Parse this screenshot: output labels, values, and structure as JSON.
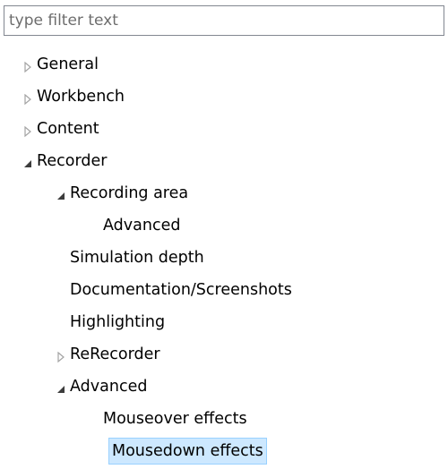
{
  "filter": {
    "placeholder": "type filter text",
    "value": ""
  },
  "colors": {
    "selection_bg": "#cde8ff",
    "selection_border": "#99d1ff",
    "twisty_collapsed": "#a3a3a3",
    "twisty_expanded": "#3c3c3c"
  },
  "tree": {
    "general": "General",
    "workbench": "Workbench",
    "content": "Content",
    "recorder": "Recorder",
    "recording_area": "Recording area",
    "recording_area_advanced": "Advanced",
    "simulation_depth": "Simulation depth",
    "documentation_screenshots": "Documentation/Screenshots",
    "highlighting": "Highlighting",
    "rerecorder": "ReRecorder",
    "advanced": "Advanced",
    "mouseover_effects": "Mouseover effects",
    "mousedown_effects": "Mousedown effects"
  },
  "selected_item": "Mousedown effects"
}
